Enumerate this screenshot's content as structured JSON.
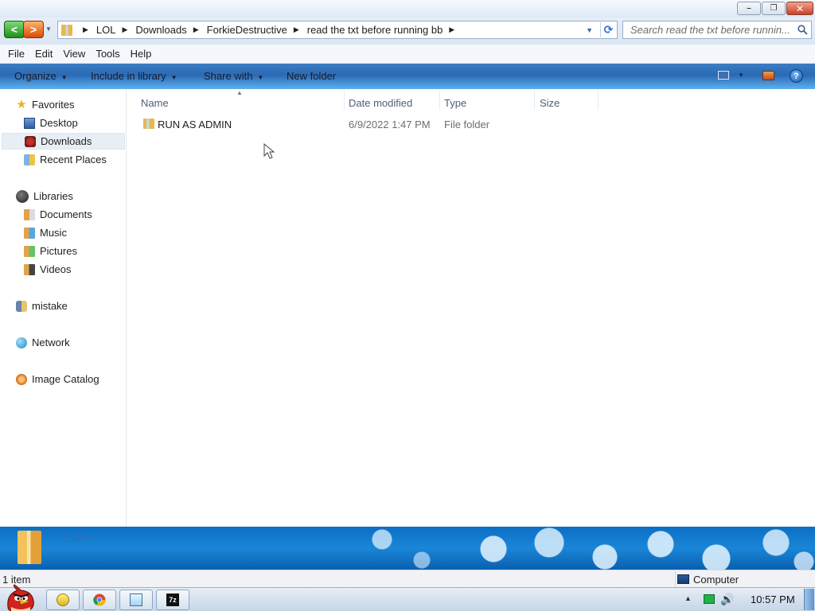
{
  "window": {
    "buttons": {
      "minimize": "–",
      "restore": "❐",
      "close": "✕"
    }
  },
  "address": {
    "breadcrumbs": [
      "LOL",
      "Downloads",
      "ForkieDestructive",
      "read the txt before running bb"
    ],
    "search_placeholder": "Search read the txt before runnin..."
  },
  "menu": [
    "File",
    "Edit",
    "View",
    "Tools",
    "Help"
  ],
  "commands": {
    "organize": "Organize",
    "include_in_library": "Include in library",
    "share_with": "Share with",
    "new_folder": "New folder"
  },
  "nav": {
    "favorites": "Favorites",
    "favorites_items": [
      "Desktop",
      "Downloads",
      "Recent Places"
    ],
    "libraries": "Libraries",
    "libraries_items": [
      "Documents",
      "Music",
      "Pictures",
      "Videos"
    ],
    "user": "mistake",
    "network": "Network",
    "image_catalog": "Image Catalog"
  },
  "columns": {
    "name": "Name",
    "date": "Date modified",
    "type": "Type",
    "size": "Size"
  },
  "files": [
    {
      "name": "RUN AS ADMIN",
      "date": "6/9/2022 1:47 PM",
      "type": "File folder",
      "size": ""
    }
  ],
  "details": {
    "count": "1 item"
  },
  "status": {
    "count": "1 item",
    "zone": "Computer"
  },
  "taskbar": {
    "clock": "10:57 PM"
  },
  "colors": {
    "command_bar": "#2a6ab5",
    "details_pane": "#1a86d8"
  }
}
